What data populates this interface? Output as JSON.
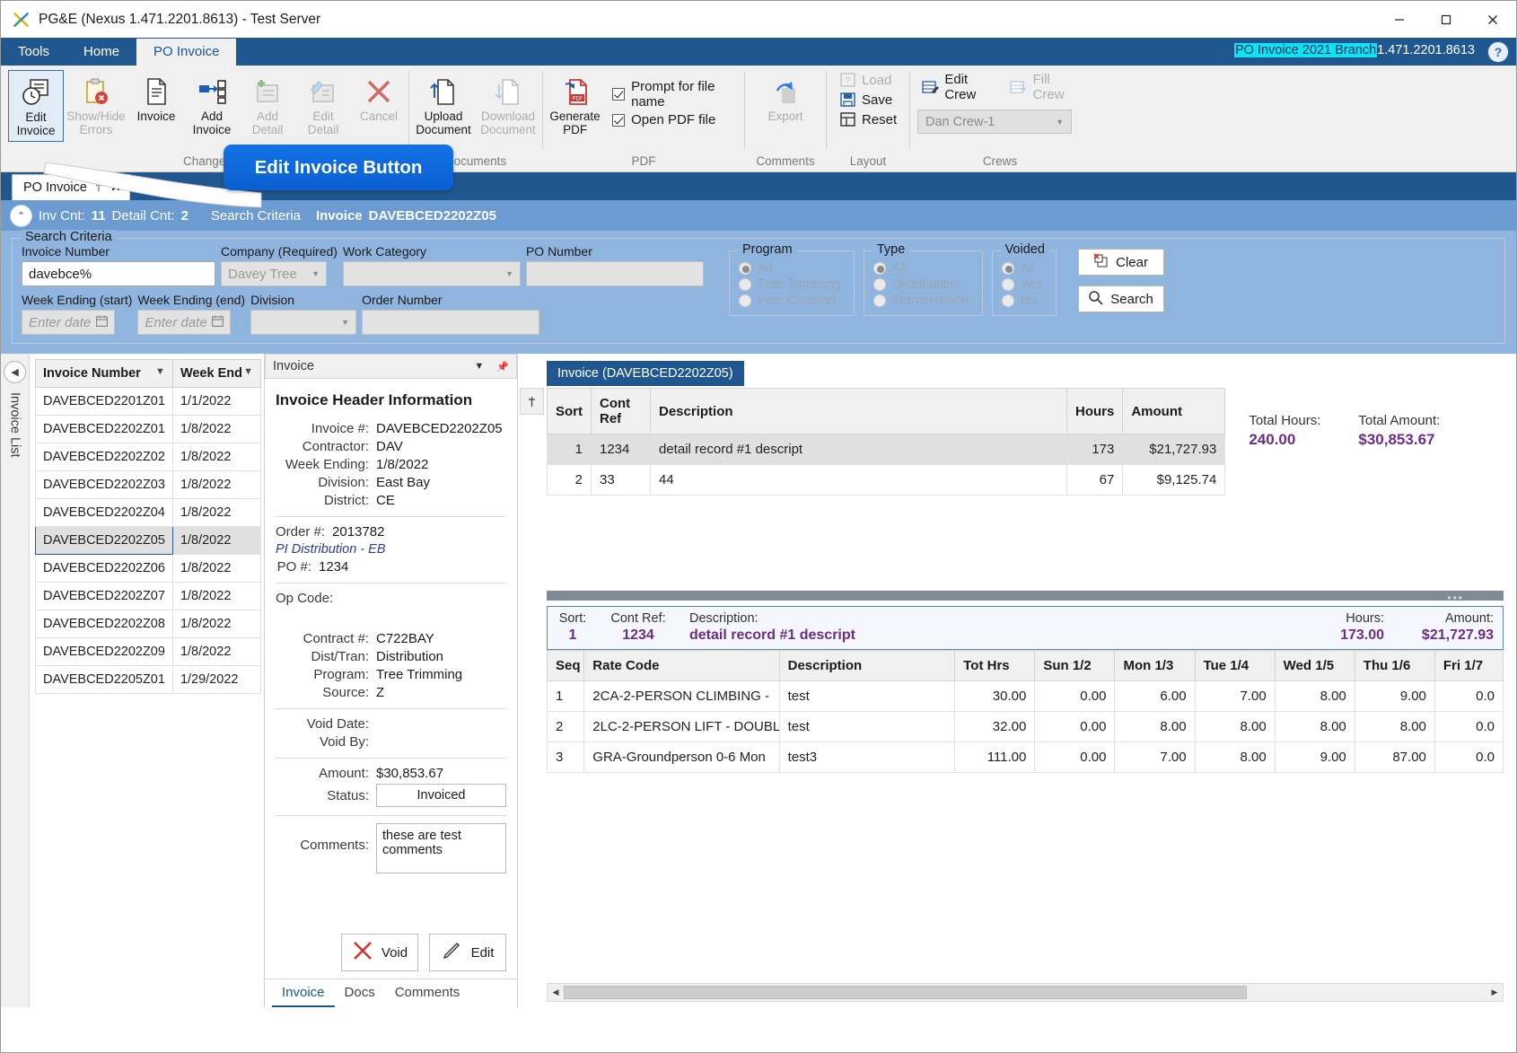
{
  "window": {
    "title": "PG&E (Nexus 1.471.2201.8613) - Test Server",
    "minimize": "—",
    "maximize": "☐",
    "close": "✕"
  },
  "ribbon": {
    "tabs": [
      {
        "label": "Tools",
        "active": false
      },
      {
        "label": "Home",
        "active": false
      },
      {
        "label": "PO Invoice",
        "active": true
      }
    ],
    "branch_label": "PO Invoice 2021 Branch",
    "version": "1.471.2201.8613",
    "help": "?",
    "groups": {
      "changes": {
        "label": "Changes",
        "buttons": [
          {
            "line1": "Edit",
            "line2": "Invoice",
            "state": "selected"
          },
          {
            "line1": "Show/Hide",
            "line2": "Errors",
            "state": "disabled"
          },
          {
            "line1": "Invoice",
            "line2": "",
            "state": "enabled"
          },
          {
            "line1": "Add",
            "line2": "Invoice",
            "state": "enabled"
          },
          {
            "line1": "Add",
            "line2": "Detail",
            "state": "disabled"
          },
          {
            "line1": "Edit",
            "line2": "Detail",
            "state": "disabled"
          },
          {
            "line1": "Cancel",
            "line2": "",
            "state": "disabled"
          }
        ]
      },
      "documents": {
        "label": "Documents",
        "buttons": [
          {
            "line1": "Upload",
            "line2": "Document",
            "state": "enabled"
          },
          {
            "line1": "Download",
            "line2": "Document",
            "state": "disabled"
          }
        ]
      },
      "pdf": {
        "label": "PDF",
        "generate": {
          "line1": "Generate",
          "line2": "PDF"
        },
        "checkboxes": [
          {
            "label": "Prompt for file name",
            "checked": true
          },
          {
            "label": "Open PDF file",
            "checked": true
          }
        ]
      },
      "comments": {
        "label": "Comments",
        "export": "Export"
      },
      "layout": {
        "label": "Layout",
        "items": [
          {
            "label": "Load",
            "state": "disabled"
          },
          {
            "label": "Save",
            "state": "enabled"
          },
          {
            "label": "Reset",
            "state": "enabled"
          }
        ]
      },
      "crews": {
        "label": "Crews",
        "edit_crew": "Edit Crew",
        "fill_crew": "Fill Crew",
        "selected_crew": "Dan Crew-1"
      }
    },
    "callout": "Edit Invoice Button"
  },
  "doc_tab": {
    "label": "PO Invoice",
    "pin": "⤒",
    "close": "✕"
  },
  "summary_bar": {
    "inv_cnt_label": "Inv Cnt:",
    "inv_cnt": "11",
    "detail_cnt_label": "Detail Cnt:",
    "detail_cnt": "2",
    "search_criteria_label": "Search Criteria",
    "invoice_label": "Invoice",
    "invoice_value": "DAVEBCED2202Z05",
    "collapse_icon": "⌃"
  },
  "search": {
    "legend": "Search Criteria",
    "invoice_number": {
      "label": "Invoice Number",
      "value": "davebce%"
    },
    "company": {
      "label": "Company (Required)",
      "value": "Davey Tree",
      "disabled": true
    },
    "work_category": {
      "label": "Work Category",
      "value": "",
      "disabled": true
    },
    "po_number": {
      "label": "PO Number",
      "value": "",
      "disabled": true
    },
    "week_ending_start": {
      "label": "Week Ending (start)",
      "placeholder": "Enter date"
    },
    "week_ending_end": {
      "label": "Week Ending (end)",
      "placeholder": "Enter date"
    },
    "division": {
      "label": "Division",
      "value": "",
      "disabled": true
    },
    "order_number": {
      "label": "Order Number",
      "value": "",
      "disabled": true
    },
    "program": {
      "legend": "Program",
      "options": [
        "All",
        "Tree Trimming",
        "Pole Clearing"
      ],
      "selected": "All"
    },
    "type": {
      "legend": "Type",
      "options": [
        "All",
        "Distribution",
        "Transmission"
      ],
      "selected": "All"
    },
    "voided": {
      "legend": "Voided",
      "options": [
        "All",
        "Yes",
        "No"
      ],
      "selected": "All"
    },
    "clear_button": "Clear",
    "search_button": "Search"
  },
  "invoice_list": {
    "vertical_label": "Invoice List",
    "columns": [
      "Invoice Number",
      "Week End"
    ],
    "rows": [
      {
        "invoice": "DAVEBCED2201Z01",
        "week_end": "1/1/2022",
        "selected": false
      },
      {
        "invoice": "DAVEBCED2202Z01",
        "week_end": "1/8/2022",
        "selected": false
      },
      {
        "invoice": "DAVEBCED2202Z02",
        "week_end": "1/8/2022",
        "selected": false
      },
      {
        "invoice": "DAVEBCED2202Z03",
        "week_end": "1/8/2022",
        "selected": false
      },
      {
        "invoice": "DAVEBCED2202Z04",
        "week_end": "1/8/2022",
        "selected": false
      },
      {
        "invoice": "DAVEBCED2202Z05",
        "week_end": "1/8/2022",
        "selected": true
      },
      {
        "invoice": "DAVEBCED2202Z06",
        "week_end": "1/8/2022",
        "selected": false
      },
      {
        "invoice": "DAVEBCED2202Z07",
        "week_end": "1/8/2022",
        "selected": false
      },
      {
        "invoice": "DAVEBCED2202Z08",
        "week_end": "1/8/2022",
        "selected": false
      },
      {
        "invoice": "DAVEBCED2202Z09",
        "week_end": "1/8/2022",
        "selected": false
      },
      {
        "invoice": "DAVEBCED2205Z01",
        "week_end": "1/29/2022",
        "selected": false
      }
    ]
  },
  "invoice_header": {
    "pane_title": "Invoice",
    "heading": "Invoice Header Information",
    "fields": [
      {
        "label": "Invoice #:",
        "value": "DAVEBCED2202Z05"
      },
      {
        "label": "Contractor:",
        "value": "DAV"
      },
      {
        "label": "Week Ending:",
        "value": "1/8/2022"
      },
      {
        "label": "Division:",
        "value": "East Bay"
      },
      {
        "label": "District:",
        "value": "CE"
      }
    ],
    "order_label": "Order #:",
    "order_value": "2013782",
    "order_link": "PI Distribution - EB",
    "po_label": "PO #:",
    "po_value": "1234",
    "op_code_label": "Op Code:",
    "op_code_value": "",
    "fields2": [
      {
        "label": "Contract #:",
        "value": "C722BAY"
      },
      {
        "label": "Dist/Tran:",
        "value": "Distribution"
      },
      {
        "label": "Program:",
        "value": "Tree Trimming"
      },
      {
        "label": "Source:",
        "value": "Z"
      }
    ],
    "fields3": [
      {
        "label": "Void Date:",
        "value": ""
      },
      {
        "label": "Void By:",
        "value": ""
      }
    ],
    "amount_label": "Amount:",
    "amount_value": "$30,853.67",
    "status_label": "Status:",
    "status_value": "Invoiced",
    "comments_label": "Comments:",
    "comments_value": "these are test comments",
    "void_button": "Void",
    "edit_button": "Edit",
    "bottom_tabs": [
      {
        "label": "Invoice",
        "active": true
      },
      {
        "label": "Docs",
        "active": false
      },
      {
        "label": "Comments",
        "active": false
      }
    ]
  },
  "invoice_grid": {
    "tab_label": "Invoice (DAVEBCED2202Z05)",
    "columns": [
      "Sort",
      "Cont Ref",
      "Description",
      "Hours",
      "Amount"
    ],
    "rows": [
      {
        "sort": "1",
        "cont_ref": "1234",
        "description": "detail record #1 descript",
        "hours": "173",
        "amount": "$21,727.93",
        "selected": true
      },
      {
        "sort": "2",
        "cont_ref": "33",
        "description": "44",
        "hours": "67",
        "amount": "$9,125.74",
        "selected": false
      }
    ],
    "total_hours_label": "Total Hours:",
    "total_hours": "240.00",
    "total_amount_label": "Total Amount:",
    "total_amount": "$30,853.67"
  },
  "detail_bar": {
    "sort_label": "Sort:",
    "sort_value": "1",
    "cont_ref_label": "Cont Ref:",
    "cont_ref_value": "1234",
    "description_label": "Description:",
    "description_value": "detail record #1 descript",
    "hours_label": "Hours:",
    "hours_value": "173.00",
    "amount_label": "Amount:",
    "amount_value": "$21,727.93"
  },
  "detail_grid": {
    "columns": [
      "Seq",
      "Rate Code",
      "Description",
      "Tot Hrs",
      "Sun 1/2",
      "Mon 1/3",
      "Tue 1/4",
      "Wed 1/5",
      "Thu 1/6",
      "Fri 1/7"
    ],
    "rows": [
      {
        "seq": "1",
        "rate_code": "2CA-2-PERSON CLIMBING - ",
        "description": "test",
        "tot_hrs": "30.00",
        "sun": "0.00",
        "mon": "6.00",
        "tue": "7.00",
        "wed": "8.00",
        "thu": "9.00",
        "fri": "0.0"
      },
      {
        "seq": "2",
        "rate_code": "2LC-2-PERSON LIFT - DOUBL",
        "description": "test",
        "tot_hrs": "32.00",
        "sun": "0.00",
        "mon": "8.00",
        "tue": "8.00",
        "wed": "8.00",
        "thu": "8.00",
        "fri": "0.0"
      },
      {
        "seq": "3",
        "rate_code": "GRA-Groundperson 0-6 Mon",
        "description": "test3",
        "tot_hrs": "111.00",
        "sun": "0.00",
        "mon": "7.00",
        "tue": "8.00",
        "wed": "9.00",
        "thu": "87.00",
        "fri": "0.0"
      }
    ]
  },
  "colors": {
    "ribbon_blue": "#21578f",
    "band_blue": "#8fb4de",
    "accent_purple": "#6b2d85",
    "callout_blue": "#0b5fd0",
    "highlight_cyan": "#11e2f2"
  }
}
